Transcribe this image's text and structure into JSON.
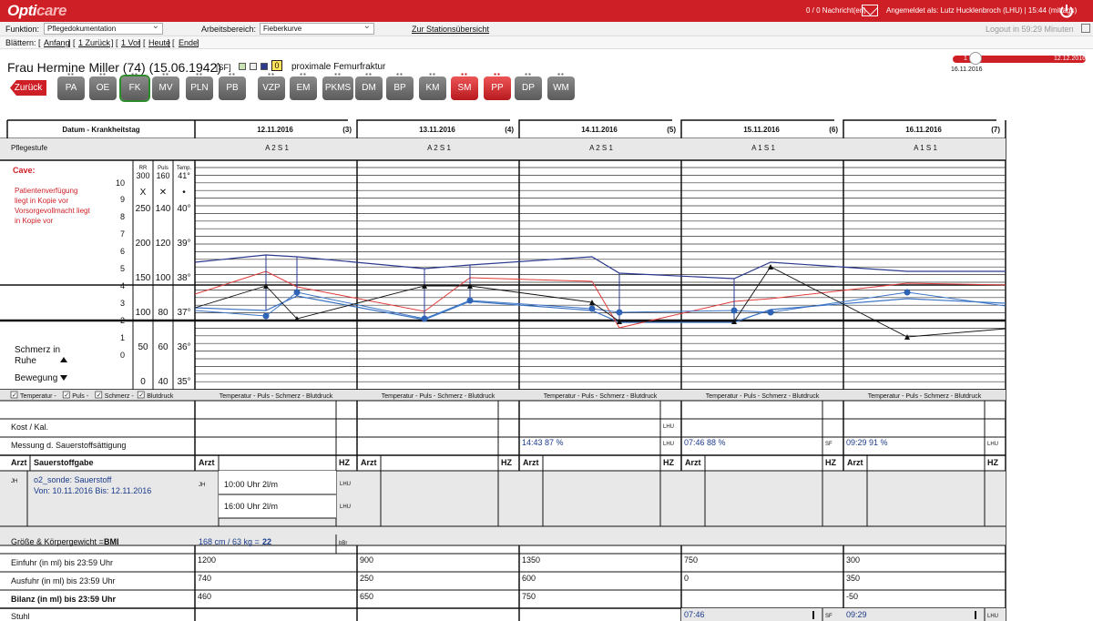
{
  "header": {
    "logo_a": "Opti",
    "logo_b": "care",
    "messages": "0 / 0 Nachricht(en)",
    "user": "Angemeldet als: Lutz Hucklenbroch (LHU) | 15:44 (mittags)"
  },
  "toolbar": {
    "funktion_label": "Funktion:",
    "funktion_value": "Pflegedokumentation",
    "arbeitsbereich_label": "Arbeitsbereich:",
    "arbeitsbereich_value": "Fieberkurve",
    "station_link": "Zur Stationsübersicht",
    "logout": "Logout in 59:29 Minuten"
  },
  "blaettern": {
    "label": "Blättern: [",
    "anfang": "Anfang",
    "sep1": "] [",
    "zurueck1": "1 Zurück",
    "sep2": "] [",
    "vor1": "1 Vor",
    "sep3": "] [",
    "heute": "Heute",
    "sep4": "] [",
    "ende": "Ende",
    "end": "]"
  },
  "patient": {
    "name": "Frau Hermine Miller (74) (15.06.1942)",
    "sf": "[SF]",
    "badge": "0",
    "diagnosis": "proximale Femurfraktur"
  },
  "nav": {
    "back": "Zurück",
    "buttons": [
      "PA",
      "OE",
      "FK",
      "MV",
      "PLN",
      "PB",
      "VZP",
      "EM",
      "PKMS",
      "DM",
      "BP",
      "KM",
      "SM",
      "PP",
      "DP",
      "WM"
    ]
  },
  "timeline": {
    "start": "1",
    "end": "12.12.2016",
    "current": "16.11.2016",
    "start_full": "12.11.2016"
  },
  "table": {
    "date_header": "Datum - Krankheitstag",
    "days": [
      {
        "date": "12.11.2016",
        "num": "(3)",
        "pflege": "A 2       S 1"
      },
      {
        "date": "13.11.2016",
        "num": "(4)",
        "pflege": "A 2       S 1"
      },
      {
        "date": "14.11.2016",
        "num": "(5)",
        "pflege": "A 2       S 1"
      },
      {
        "date": "15.11.2016",
        "num": "(6)",
        "pflege": "A 1       S 1"
      },
      {
        "date": "16.11.2016",
        "num": "(7)",
        "pflege": "A 1       S 1"
      }
    ],
    "pflegestufe": "Pflegestufe",
    "cave": "Cave:",
    "cave_text1": "Patientenverfügung liegt in Kopie vor",
    "cave_text2": "Vorsorgevollmacht liegt in Kopie vor",
    "col_rr": "RR",
    "col_puls": "Puls",
    "col_temp": "Temp.",
    "pain_scale": [
      "10",
      "9",
      "8",
      "7",
      "6",
      "5",
      "4",
      "3",
      "2",
      "1",
      "0"
    ],
    "rr_scale": [
      "300",
      "250",
      "200",
      "150",
      "100",
      "50",
      "0"
    ],
    "puls_scale": [
      "160",
      "140",
      "120",
      "100",
      "80",
      "60",
      "40"
    ],
    "temp_scale": [
      "41°",
      "40°",
      "39°",
      "38°",
      "37°",
      "36°",
      "35°"
    ],
    "schmerz": "Schmerz in Ruhe",
    "bewegung": "Bewegung",
    "legend_checks": [
      "Temperatur -",
      "Puls -",
      "Schmerz -",
      "Blutdruck"
    ],
    "legend_day": "Temperatur - Puls - Schmerz - Blutdruck",
    "kost": "Kost / Kal.",
    "sauer_label": "Messung d. Sauerstoffsättigung",
    "sauer_vals": [
      "",
      "",
      "14:43  87 %",
      "07:46  88 %",
      "09:29  91 %"
    ],
    "sauer_sig": [
      "",
      "",
      "LHU",
      "SF",
      "LHU"
    ],
    "kost_sig": [
      "",
      "",
      "LHU",
      "",
      ""
    ],
    "arzt": "Arzt",
    "hz": "HZ",
    "sauerstoffgabe": "Sauerstoffgabe",
    "o2_sig": "JH",
    "o2_text1": "o2_sonde: Sauerstoff",
    "o2_text2": "Von: 10.11.2016 Bis: 12.11.2016",
    "o2_day_sig": "JH",
    "o2_entry1": "10:00 Uhr 2l/m",
    "o2_entry2": "16:00 Uhr 2l/m",
    "o2_lhu": "LHU",
    "bmi_label": "Größe & Körpergewicht = ",
    "bmi_bold": "BMI",
    "bmi_val": "168 cm / 63 kg = ",
    "bmi_num": "22",
    "bmi_sig": "bBr",
    "einfuhr": "Einfuhr (in ml) bis 23:59 Uhr",
    "einfuhr_vals": [
      "1200",
      "900",
      "1350",
      "750",
      "300"
    ],
    "ausfuhr": "Ausfuhr (in ml) bis 23:59 Uhr",
    "ausfuhr_vals": [
      "740",
      "250",
      "600",
      "0",
      "350"
    ],
    "bilanz": "Bilanz (in ml) bis 23:59 Uhr",
    "bilanz_vals": [
      "460",
      "650",
      "750",
      "",
      "-50"
    ],
    "stuhl": "Stuhl",
    "stuhl_vals": [
      "",
      "",
      "",
      "07:46",
      "09:29"
    ],
    "stuhl_sig": [
      "",
      "",
      "",
      "SF",
      "LHU"
    ]
  },
  "colors": {
    "brand": "#cf1f26",
    "bp": "#2b3a8f",
    "puls": "#e23a3a",
    "temp": "#3b74c4",
    "pain": "#111111"
  }
}
